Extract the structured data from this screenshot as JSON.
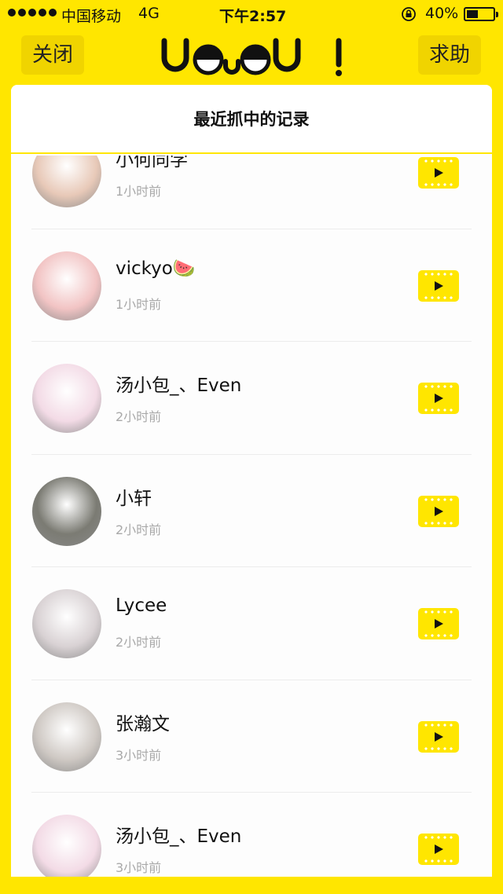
{
  "status_bar": {
    "carrier": "中国移动",
    "network": "4G",
    "time": "下午2:57",
    "battery": "40%",
    "battery_level": 0.4
  },
  "header": {
    "close_label": "关闭",
    "help_label": "求助",
    "logo_text": "UOUOU!"
  },
  "panel": {
    "title": "最近抓中的记录"
  },
  "records": [
    {
      "name": "小何同学",
      "time": "1小时前",
      "avatar_color": "#e8c9b8"
    },
    {
      "name": "vickyo🍉",
      "time": "1小时前",
      "avatar_color": "#f2c4c4"
    },
    {
      "name": "汤小包_、Even",
      "time": "2小时前",
      "avatar_color": "#f3dbe6"
    },
    {
      "name": "小轩",
      "time": "2小时前",
      "avatar_color": "#7b7b73"
    },
    {
      "name": "Lycee",
      "time": "2小时前",
      "avatar_color": "#d9d2d4"
    },
    {
      "name": "张瀚文",
      "time": "3小时前",
      "avatar_color": "#cfc9c4"
    },
    {
      "name": "汤小包_、Even",
      "time": "3小时前",
      "avatar_color": "#f3dbe6"
    }
  ]
}
